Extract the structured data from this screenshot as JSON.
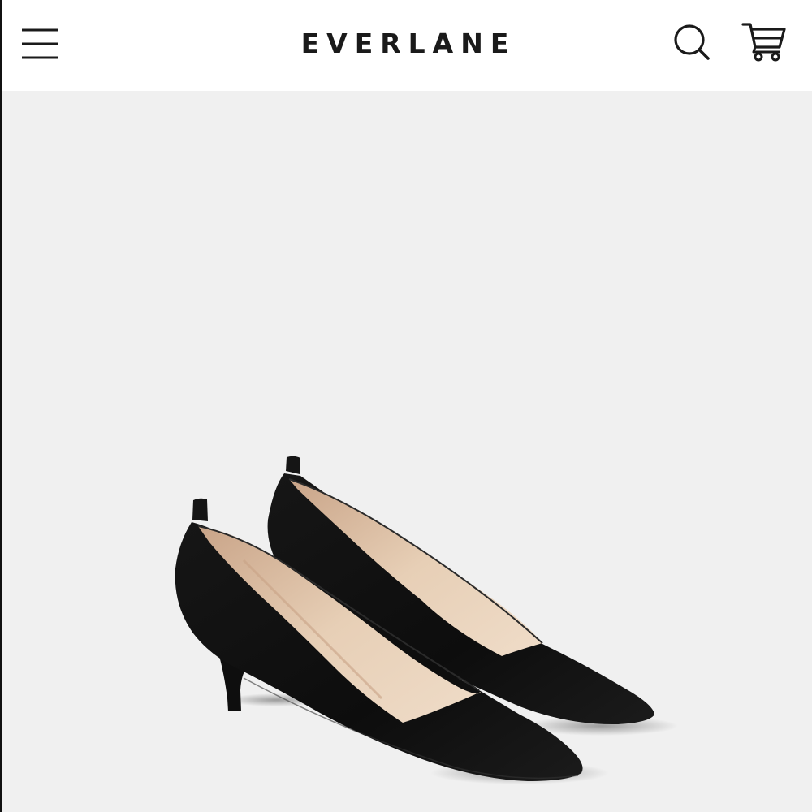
{
  "header": {
    "brand": "EVERLANE",
    "menu_icon": "hamburger-menu-icon",
    "search_icon": "search-icon",
    "cart_icon": "shopping-cart-icon"
  },
  "hero": {
    "image_subject": "product-image",
    "background_color": "#f0f0f0"
  },
  "colors": {
    "header_bg": "#ffffff",
    "text": "#1a1a1a",
    "shoe_body": "#111111",
    "shoe_lining": "#e2c6ab"
  }
}
